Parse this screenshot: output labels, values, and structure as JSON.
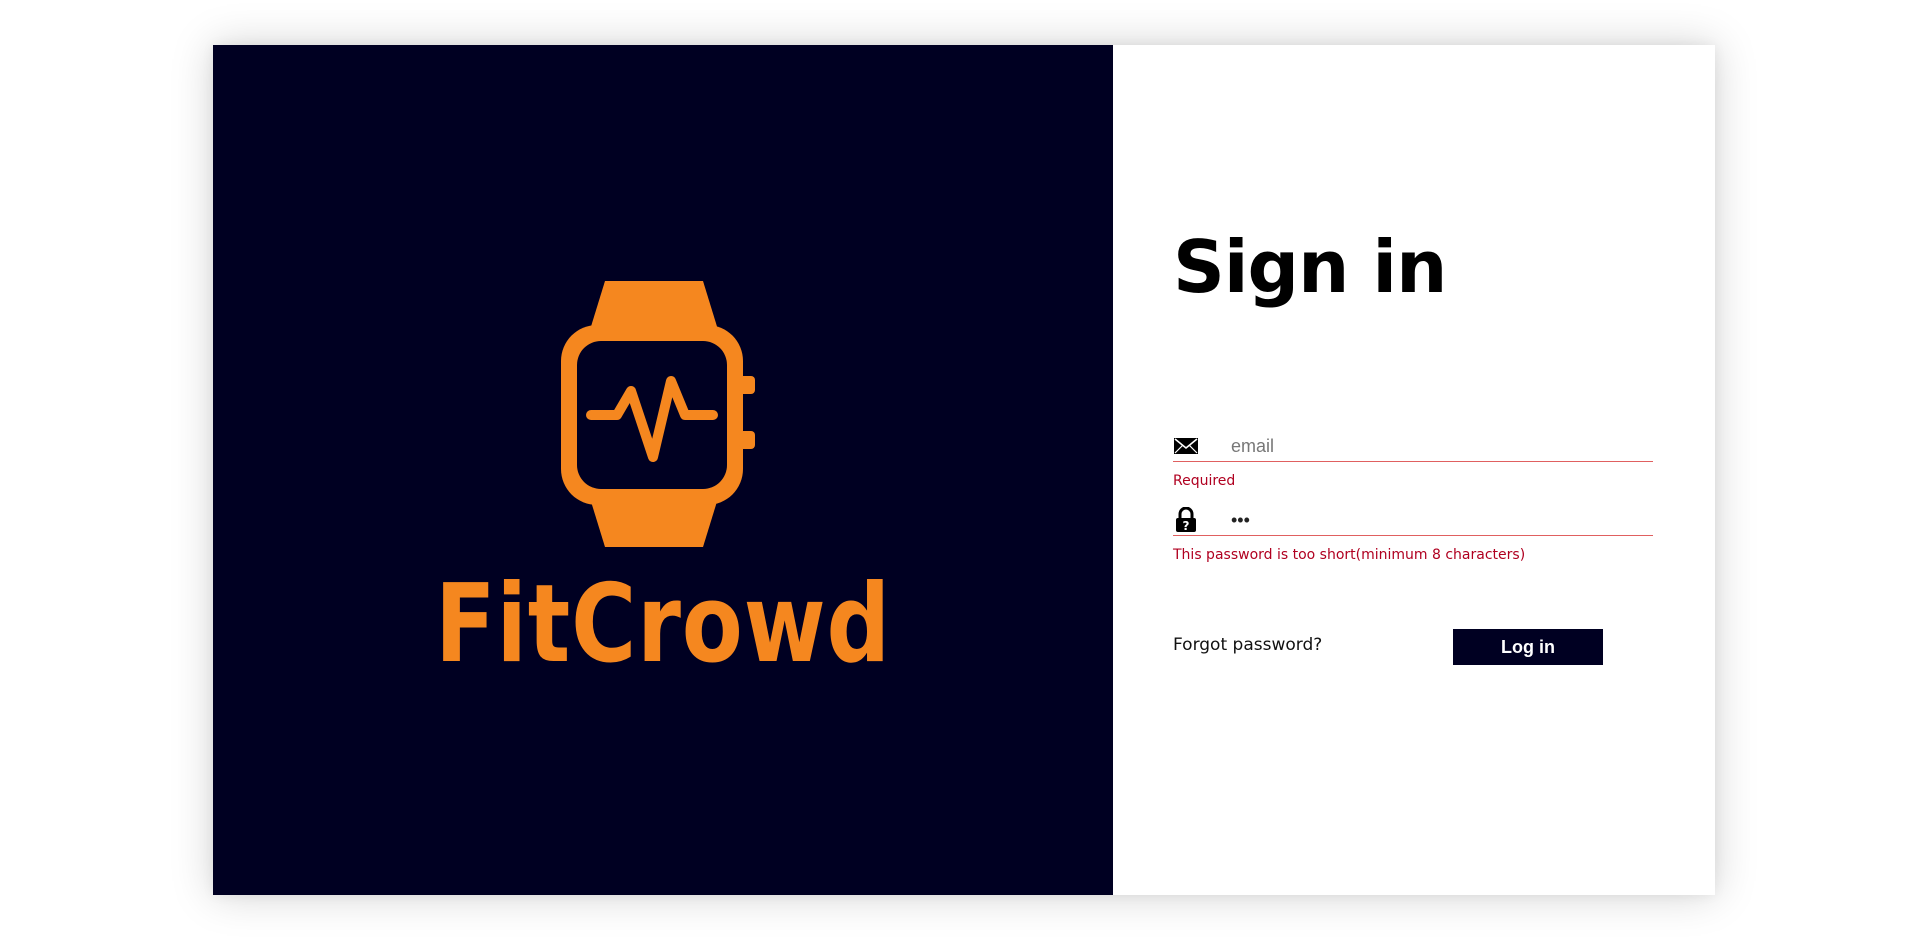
{
  "brand": {
    "name": "FitCrowd",
    "logo_icon": "smartwatch-heartbeat-icon",
    "colors": {
      "panel_background": "#000022",
      "accent": "#F5871F"
    }
  },
  "form": {
    "title": "Sign in",
    "email": {
      "icon": "envelope-icon",
      "placeholder": "email",
      "value": "",
      "error": "Required"
    },
    "password": {
      "icon": "padlock-icon",
      "value": "abc",
      "error": "This password is too short(minimum 8 characters)"
    },
    "forgot_label": "Forgot password?",
    "login_label": "Log in",
    "colors": {
      "error": "#b00020",
      "field_underline": "#e06060"
    }
  }
}
